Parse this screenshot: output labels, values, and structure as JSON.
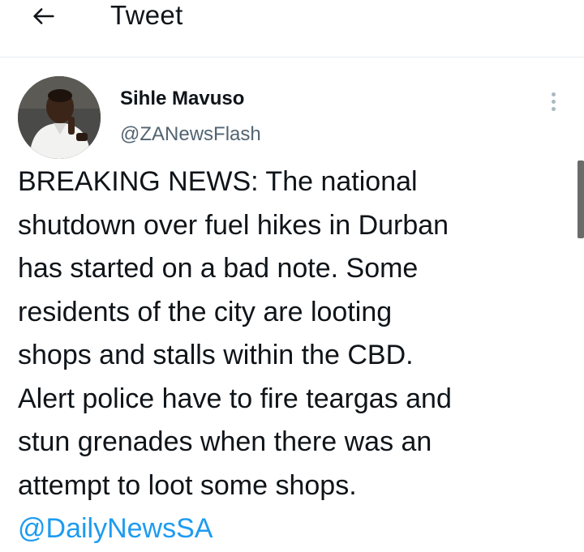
{
  "header": {
    "title": "Tweet",
    "back_icon": "arrow-left-icon"
  },
  "tweet": {
    "author_name": "Sihle Mavuso",
    "author_handle": "@ZANewsFlash",
    "more_icon": "more-vertical-icon",
    "lines": [
      "BREAKING NEWS: The national",
      "shutdown over fuel hikes in Durban",
      "has started on a bad note. Some",
      "residents of the city are looting",
      "shops and stalls within the CBD.",
      "Alert police have to fire teargas and",
      "stun grenades when there was an",
      "attempt to loot some shops."
    ],
    "mention": "@DailyNewsSA"
  },
  "colors": {
    "text": "#0f1419",
    "secondary": "#536471",
    "link": "#1d9bf0",
    "divider": "#e6ecf0"
  }
}
